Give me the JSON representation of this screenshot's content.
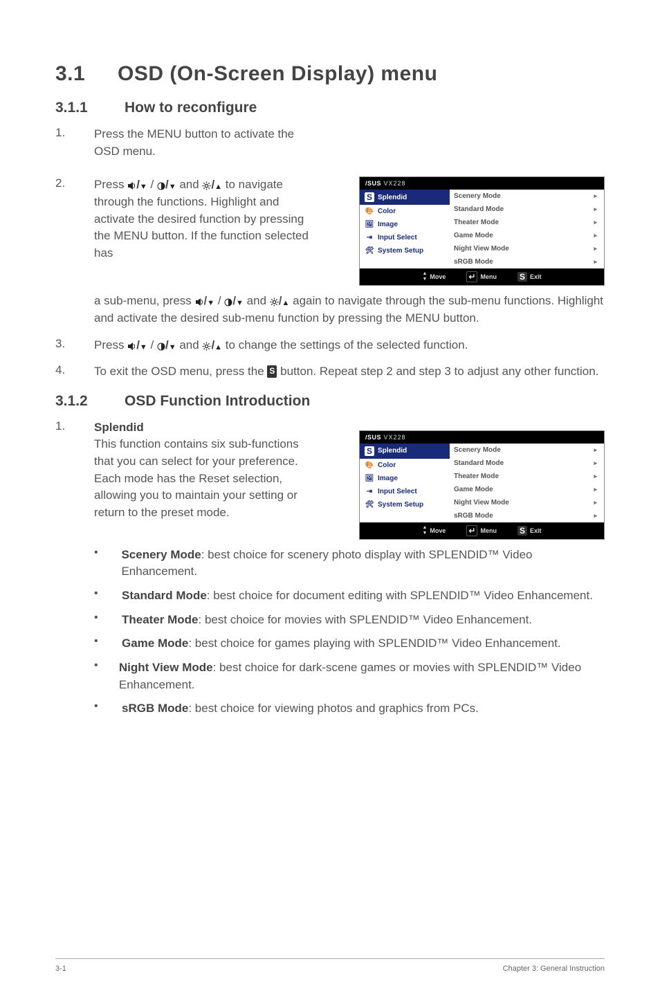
{
  "h1_num": "3.1",
  "h1_title": "OSD (On-Screen Display) menu",
  "s311_num": "3.1.1",
  "s311_title": "How to reconfigure",
  "step1_num": "1.",
  "step1_text": "Press the MENU button to activate the OSD menu.",
  "step2_num": "2.",
  "step2a": "Press ",
  "step2b": " and ",
  "step2c": " to navigate through the functions. Highlight and activate the desired function by pressing the MENU button. If the function selected has a sub-menu, press ",
  "step2d": " and ",
  "step2e": " again to navigate through the sub-menu functions. Highlight and activate the desired sub-menu function by pressing the MENU button.",
  "step3_num": "3.",
  "step3a": "Press ",
  "step3b": " and ",
  "step3c": " to change the settings of the selected function.",
  "step4_num": "4.",
  "step4a": "To exit the OSD menu, press the ",
  "step4b": " button. Repeat step 2 and step 3 to adjust any other function.",
  "s312_num": "3.1.2",
  "s312_title": "OSD Function Introduction",
  "sp_num": "1.",
  "sp_title": "Splendid",
  "sp_body": "This function contains six sub-functions that you can select for your preference. Each mode has the Reset selection, allowing you to maintain your setting or return to the preset mode.",
  "bullets": {
    "scenery_b": "Scenery Mode",
    "scenery_t": ": best choice for scenery photo display with SPLENDID™ Video Enhancement.",
    "standard_b": "Standard Mode",
    "standard_t": ": best choice for document editing with SPLENDID™ Video Enhancement.",
    "theater_b": "Theater Mode",
    "theater_t": ": best choice for movies with SPLENDID™ Video Enhancement.",
    "game_b": "Game Mode",
    "game_t": ": best choice for games playing with SPLENDID™ Video Enhancement.",
    "night_b": "Night View Mode",
    "night_t": ": best choice for dark-scene games or movies with SPLENDID™ Video Enhancement.",
    "srgb_b": "sRGB Mode",
    "srgb_t": ": best choice for viewing photos and graphics from PCs."
  },
  "osd": {
    "brand": "/SUS",
    "model": "VX228",
    "side": {
      "splendid": "Splendid",
      "color": "Color",
      "image": "Image",
      "input": "Input Select",
      "system": "System Setup"
    },
    "modes": {
      "scenery": "Scenery Mode",
      "standard": "Standard Mode",
      "theater": "Theater Mode",
      "game": "Game Mode",
      "night": "Night View Mode",
      "srgb": "sRGB Mode"
    },
    "foot": {
      "move": "Move",
      "menu": "Menu",
      "exit": "Exit"
    }
  },
  "footer_left": "3-1",
  "footer_right": "Chapter 3: General Instruction"
}
